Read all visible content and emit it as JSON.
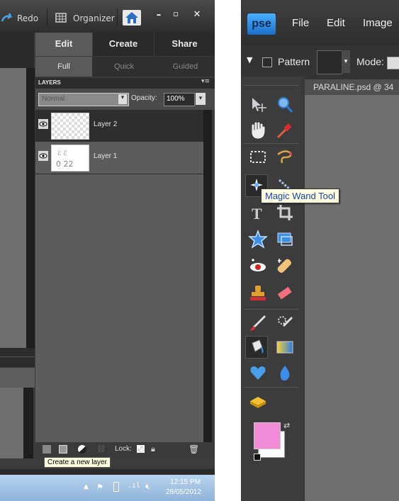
{
  "left_panel": {
    "titlebar": {
      "redo_label": "Redo",
      "organizer_label": "Organizer"
    },
    "mode_tabs": [
      {
        "label": "Edit",
        "active": true
      },
      {
        "label": "Create",
        "active": false
      },
      {
        "label": "Share",
        "active": false
      }
    ],
    "edit_modes": [
      {
        "label": "Full",
        "active": true
      },
      {
        "label": "Quick",
        "active": false
      },
      {
        "label": "Guided",
        "active": false
      }
    ],
    "layers_panel": {
      "title": "LAYERS",
      "blend_mode": "Normal",
      "opacity_label": "Opacity:",
      "opacity_value": "100%",
      "layers": [
        {
          "name": "Layer 2",
          "thumbnail": "transparent",
          "selected": true
        },
        {
          "name": "Layer 1",
          "thumbnail": "white-sketch",
          "selected": false
        }
      ],
      "lock_label": "Lock:"
    },
    "tooltip": "Create a new layer",
    "taskbar": {
      "time": "12:15 PM",
      "date": "28/05/2012"
    }
  },
  "right_panel": {
    "logo": "pse",
    "menu": [
      "File",
      "Edit",
      "Image"
    ],
    "options_bar": {
      "pattern_label": "Pattern",
      "mode_label": "Mode:"
    },
    "document_tab": "PARALINE.psd @ 34",
    "tooltip": "Magic Wand Tool",
    "colors": {
      "foreground": "#f28bd6",
      "background": "#ffffff",
      "accent_blue": "#3b8fe8"
    }
  }
}
